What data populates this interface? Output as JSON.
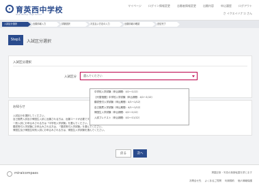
{
  "header": {
    "school_name": "育英西中学校",
    "school_sub": "Ikuei Nishi Jr. High School",
    "nav": [
      "マイページ",
      "ログイン情報変更",
      "志願者情報変更",
      "出願内容",
      "申込履歴",
      "ログアウト"
    ],
    "user": "さ イクエイハナコ さん"
  },
  "steps": [
    "入試区分選択",
    "出願情報入力",
    "試験選択",
    "お支払い方法の入力",
    "出願情報の確認",
    "送信完了"
  ],
  "step1": {
    "badge": "Step1",
    "title": "入試区分選択"
  },
  "select_section": {
    "heading": "入試区分選択",
    "field_label": "入試区分",
    "selected_value": "選んでください",
    "options": [
      "中学校入学試験（申込期間：4/1〜1/12）",
      "【代替措置】中学校入学試験（申込期間：4/1〜1/12）",
      "願書受付入学試験（申込期間：4/1〜1/12）",
      "自己推薦入学試験（申込期間：4/1〜1/12）",
      "帰国生入学試験（申込期間：4/1〜1/12）",
      "入試プレテスト（申込期間：4/1〜11/12）"
    ]
  },
  "notice": {
    "heading": "お知らせ",
    "lines": [
      "入試区分を選択してください。",
      "自己推薦入試及び帰国生入試に出願される方は、出願コードが必要です。",
      "一般入試にお申込みされる方は「中学校入学試験」を選んでください。",
      "願書受付入学試験にお申込みされる方は、「願書受付入学試験」を選んでください。",
      "帰国生及び帰国生特別入試にお申込みされる方は、帰国生入学試験を選んでください。"
    ]
  },
  "buttons": {
    "back": "戻る",
    "next": "次へ"
  },
  "footer": {
    "brand": "miraicompass",
    "copy": "掲載記事・写真の無断転載を禁じます",
    "links": [
      "お問合せ先",
      "よくあるご質問",
      "利用規約",
      "個人情報保護"
    ]
  },
  "colors": {
    "brand": "#2a4b8d",
    "focus": "#c2185b"
  }
}
